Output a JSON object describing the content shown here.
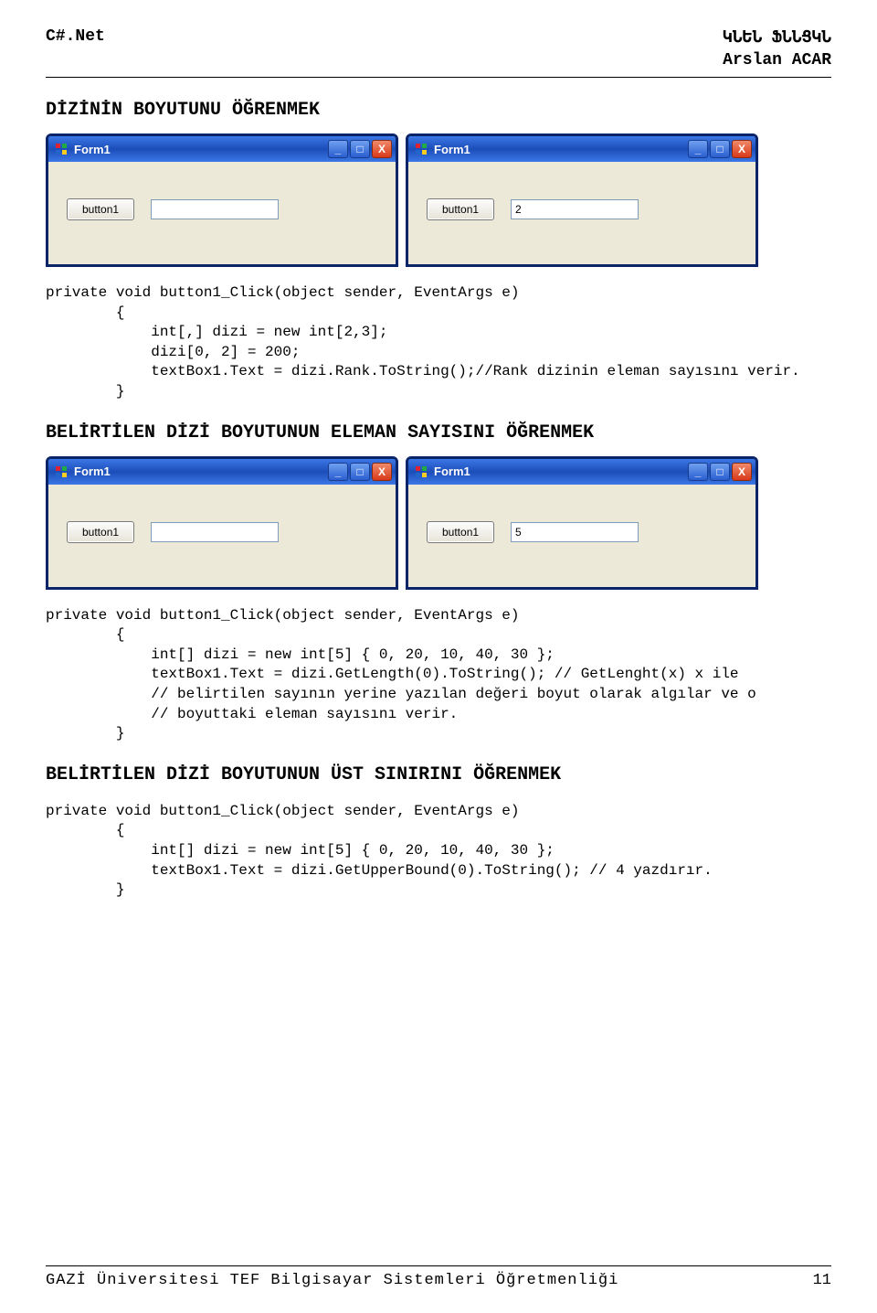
{
  "header": {
    "left": "C#.Net",
    "right_top": "ԿՆԵՆ ՖՆՆՑԿՆ",
    "author": "Arslan ACAR"
  },
  "section1": {
    "title": "DİZİNİN BOYUTUNU ÖĞRENMEK",
    "windows": [
      {
        "title": "Form1",
        "button": "button1",
        "textbox": ""
      },
      {
        "title": "Form1",
        "button": "button1",
        "textbox": "2"
      }
    ],
    "code": "private void button1_Click(object sender, EventArgs e)\n        {\n            int[,] dizi = new int[2,3];\n            dizi[0, 2] = 200;\n            textBox1.Text = dizi.Rank.ToString();//Rank dizinin eleman sayısını verir.\n        }"
  },
  "section2": {
    "title": "BELİRTİLEN DİZİ BOYUTUNUN ELEMAN SAYISINI ÖĞRENMEK",
    "windows": [
      {
        "title": "Form1",
        "button": "button1",
        "textbox": ""
      },
      {
        "title": "Form1",
        "button": "button1",
        "textbox": "5"
      }
    ],
    "code": "private void button1_Click(object sender, EventArgs e)\n        {\n            int[] dizi = new int[5] { 0, 20, 10, 40, 30 };\n            textBox1.Text = dizi.GetLength(0).ToString(); // GetLenght(x) x ile\n            // belirtilen sayının yerine yazılan değeri boyut olarak algılar ve o\n            // boyuttaki eleman sayısını verir.\n        }"
  },
  "section3": {
    "title": "BELİRTİLEN DİZİ BOYUTUNUN ÜST SINIRINI ÖĞRENMEK",
    "code": "private void button1_Click(object sender, EventArgs e)\n        {\n            int[] dizi = new int[5] { 0, 20, 10, 40, 30 };\n            textBox1.Text = dizi.GetUpperBound(0).ToString(); // 4 yazdırır.\n        }"
  },
  "footer": {
    "left": "GAZİ Üniversitesi TEF Bilgisayar Sistemleri Öğretmenliği",
    "page": "11"
  },
  "icons": {
    "min": "_",
    "max": "□",
    "close": "X"
  }
}
